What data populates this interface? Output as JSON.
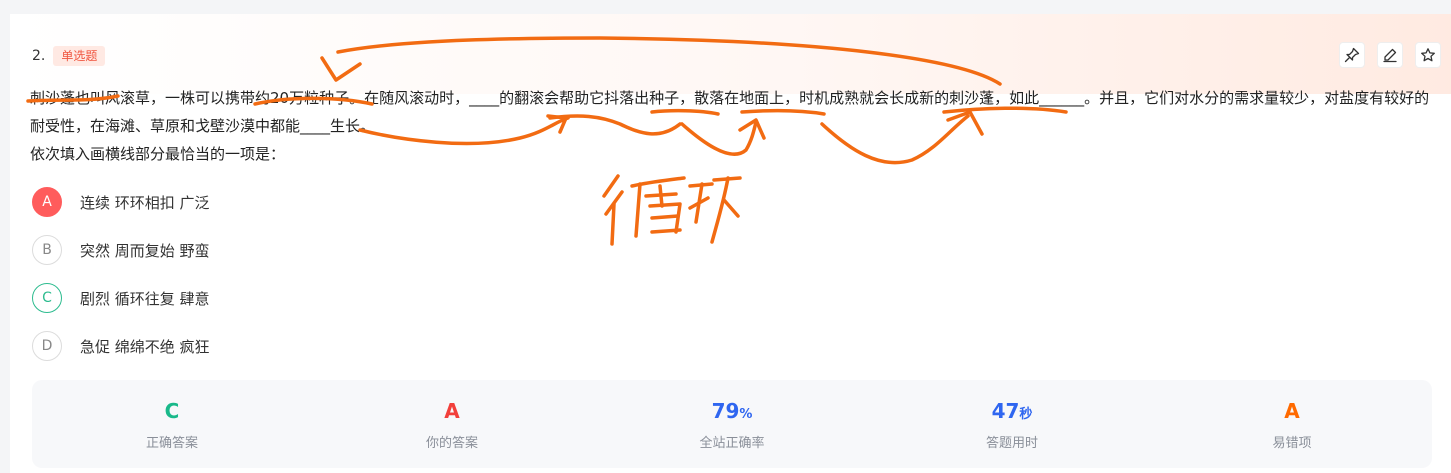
{
  "question": {
    "number": "2.",
    "type": "单选题",
    "stem": "刺沙蓬也叫风滚草，一株可以携带约20万粒种子。在随风滚动时，____的翻滚会帮助它抖落出种子，散落在地面上，时机成熟就会长成新的刺沙蓬，如此______。并且，它们对水分的需求量较少，对盐度有较好的耐受性，在海滩、草原和戈壁沙漠中都能____生长。",
    "prompt": "依次填入画横线部分最恰当的一项是："
  },
  "tools": {
    "pin_icon": "pin-icon",
    "edit_icon": "pencil-icon",
    "fav_icon": "star-icon"
  },
  "options": [
    {
      "letter": "A",
      "text": "连续 环环相扣 广泛",
      "state": "wrong"
    },
    {
      "letter": "B",
      "text": "突然 周而复始 野蛮",
      "state": "normal"
    },
    {
      "letter": "C",
      "text": "剧烈 循环往复 肆意",
      "state": "correct"
    },
    {
      "letter": "D",
      "text": "急促 绵绵不绝 疯狂",
      "state": "normal"
    }
  ],
  "stats": [
    {
      "value": "C",
      "unit": "",
      "label": "正确答案",
      "color": "#19b98a"
    },
    {
      "value": "A",
      "unit": "",
      "label": "你的答案",
      "color": "#f2403b"
    },
    {
      "value": "79",
      "unit": "%",
      "label": "全站正确率",
      "color": "#2f66f0"
    },
    {
      "value": "47",
      "unit": "秒",
      "label": "答题用时",
      "color": "#2f66f0"
    },
    {
      "value": "A",
      "unit": "",
      "label": "易错项",
      "color": "#ff6a00"
    }
  ],
  "annotation": {
    "handwriting": "循环",
    "color": "#f26b12"
  }
}
